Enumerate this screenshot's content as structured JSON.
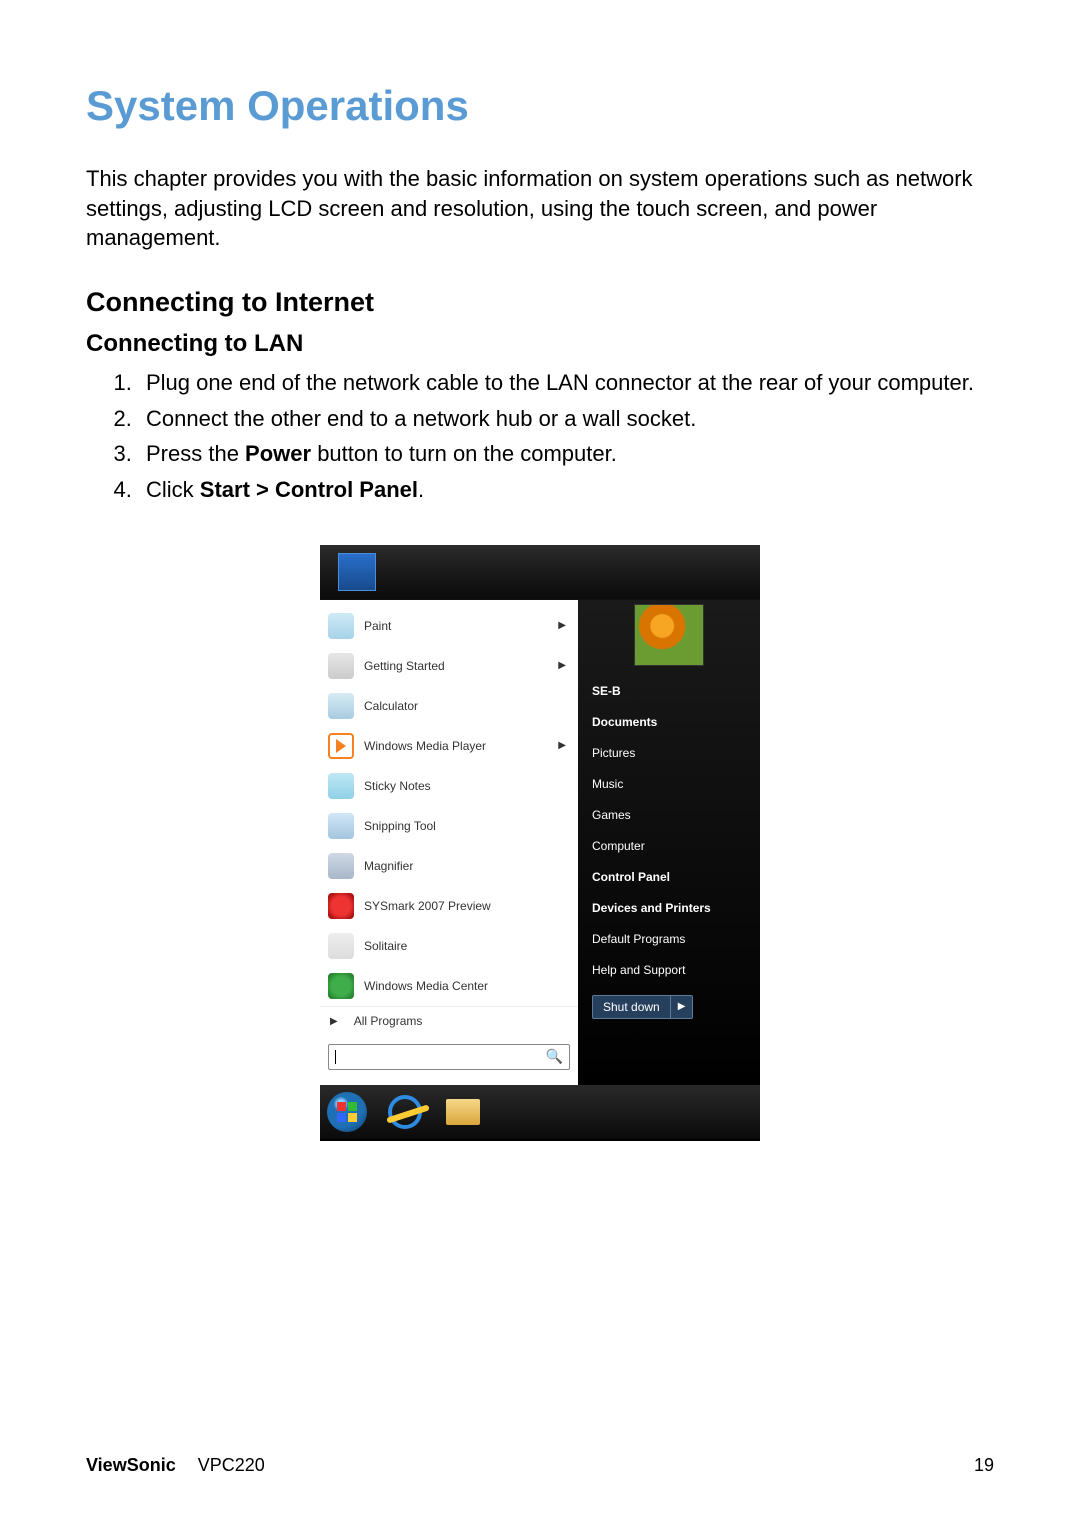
{
  "title": "System Operations",
  "intro": "This chapter provides you with the basic information on system operations such as network settings, adjusting LCD screen and resolution, using the touch screen, and power management.",
  "section": "Connecting to Internet",
  "subsection": "Connecting to LAN",
  "steps": {
    "s1": "Plug one end of the network cable to the LAN connector at the rear of your computer.",
    "s2": "Connect the other end to a network hub or a wall socket.",
    "s3a": "Press the ",
    "s3b": "Power",
    "s3c": " button to turn on the computer.",
    "s4a": "Click ",
    "s4b": "Start > Control Panel",
    "s4c": "."
  },
  "startmenu": {
    "left": {
      "items": [
        {
          "label": "Paint",
          "arrow": true,
          "icon": "ic-paint"
        },
        {
          "label": "Getting Started",
          "arrow": true,
          "icon": "ic-gs"
        },
        {
          "label": "Calculator",
          "arrow": false,
          "icon": "ic-calc"
        },
        {
          "label": "Windows Media Player",
          "arrow": true,
          "icon": "ic-wmp"
        },
        {
          "label": "Sticky Notes",
          "arrow": false,
          "icon": "ic-sticky"
        },
        {
          "label": "Snipping Tool",
          "arrow": false,
          "icon": "ic-snip"
        },
        {
          "label": "Magnifier",
          "arrow": false,
          "icon": "ic-mag"
        },
        {
          "label": "SYSmark 2007 Preview",
          "arrow": false,
          "icon": "ic-sys"
        },
        {
          "label": "Solitaire",
          "arrow": false,
          "icon": "ic-sol"
        },
        {
          "label": "Windows Media Center",
          "arrow": false,
          "icon": "ic-wmc"
        }
      ],
      "all_programs": "All Programs"
    },
    "right": {
      "user": "SE-B",
      "items": [
        "Documents",
        "Pictures",
        "Music",
        "Games",
        "Computer",
        "Control Panel",
        "Devices and Printers",
        "Default Programs",
        "Help and Support"
      ],
      "shutdown": "Shut down"
    }
  },
  "footer": {
    "brand": "ViewSonic",
    "model": "VPC220",
    "page": "19"
  }
}
